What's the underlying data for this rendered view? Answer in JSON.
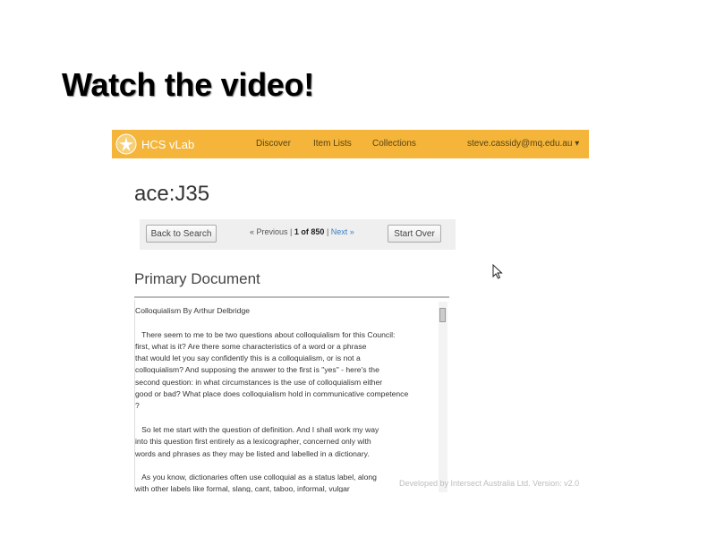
{
  "slide": {
    "title": "Watch the video!"
  },
  "navbar": {
    "brand": "HCS vLab",
    "links": [
      "Discover",
      "Item Lists",
      "Collections"
    ],
    "user": "steve.cassidy@mq.edu.au ▾"
  },
  "document": {
    "id": "ace:J35",
    "back_button": "Back to Search",
    "pager": {
      "previous": "« Previous",
      "position": "1 of 850",
      "next": "Next »"
    },
    "start_over_button": "Start Over",
    "section_title": "Primary Document",
    "text": "Colloquialism By Arthur Delbridge\n\n   There seem to me to be two questions about colloquialism for this Council:\nfirst, what is it? Are there some characteristics of a word or a phrase\nthat would let you say confidently this is a colloquialism, or is not a\ncolloquialism? And supposing the answer to the first is \"yes\" - here's the\nsecond question: in what circumstances is the use of colloquialism either\ngood or bad? What place does colloquialism hold in communicative competence\n?\n\n   So let me start with the question of definition. And I shall work my way\ninto this question first entirely as a lexicographer, concerned only with\nwords and phrases as they may be listed and labelled in a dictionary.\n\n   As you know, dictionaries often use colloquial as a status label, along\nwith other labels like formal, slang, cant, taboo, informal, vulgar"
  },
  "footer": "Developed by Intersect Australia Ltd. Version: v2.0"
}
